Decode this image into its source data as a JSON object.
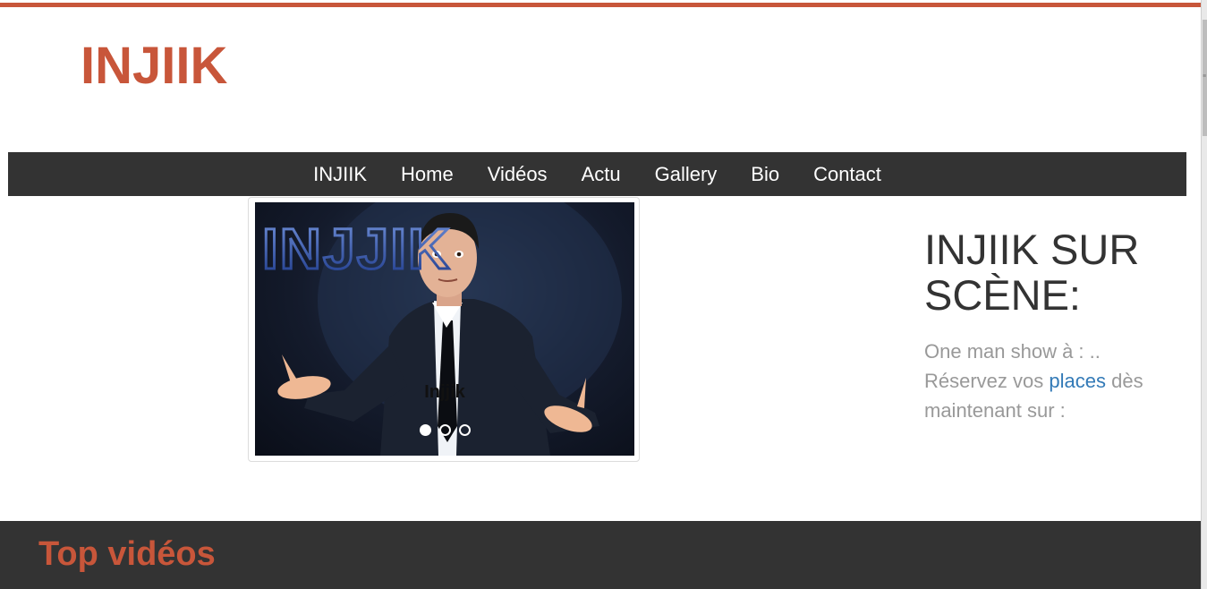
{
  "brand": {
    "logo_text": "INJIIK",
    "accent_color": "#c8563a"
  },
  "nav": {
    "items": [
      {
        "label": "INJIIK"
      },
      {
        "label": "Home"
      },
      {
        "label": "Vidéos"
      },
      {
        "label": "Actu"
      },
      {
        "label": "Gallery"
      },
      {
        "label": "Bio"
      },
      {
        "label": "Contact"
      }
    ]
  },
  "carousel": {
    "image_logo_text": "INJJIK",
    "caption": "Injjik",
    "slide_count": 3,
    "active_index": 0
  },
  "sidebar": {
    "title": "INJIIK SUR SCÈNE:",
    "text_line1": "One man show à : ..",
    "text_line2_before": "Réservez vos ",
    "link_label": "places",
    "text_line2_after": " dès",
    "text_line3": "maintenant sur :"
  },
  "section": {
    "title": "Top vidéos"
  }
}
